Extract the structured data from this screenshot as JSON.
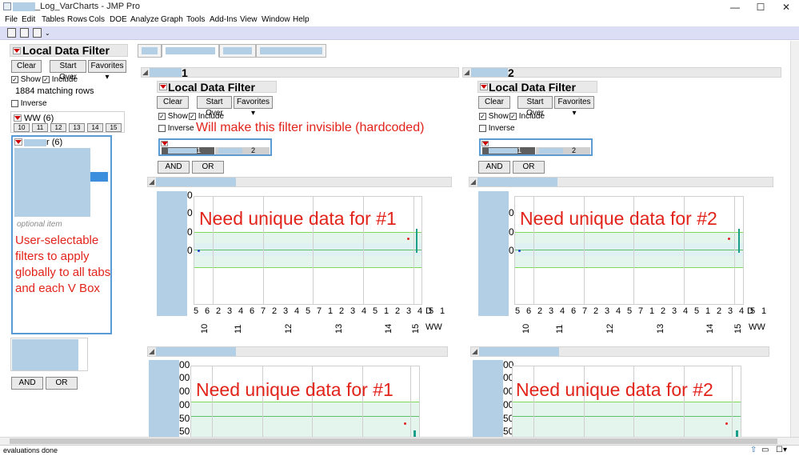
{
  "window": {
    "title_suffix": "_Log_VarCharts - JMP Pro",
    "minimize": "—",
    "maximize": "☐",
    "close": "✕"
  },
  "menu": [
    "File",
    "Edit",
    "Tables",
    "Rows",
    "Cols",
    "DOE",
    "Analyze",
    "Graph",
    "Tools",
    "Add-Ins",
    "View",
    "Window",
    "Help"
  ],
  "left_filter": {
    "title": "Local Data Filter",
    "clear": "Clear",
    "start_over": "Start Over",
    "favorites": "Favorites",
    "show": "Show",
    "include": "Include",
    "matching": "1884 matching rows",
    "inverse": "Inverse",
    "ww_label": "WW (6)",
    "ww_values": [
      "10",
      "11",
      "12",
      "13",
      "14",
      "15"
    ],
    "second_label_suffix": "r (6)",
    "optional_item": "optional item",
    "and": "AND",
    "or": "OR"
  },
  "annotations": {
    "left": "User-selectable filters to apply globally to all tabs and each V Box",
    "invisible": "Will make this filter invisible (hardcoded)",
    "need1": "Need unique data for #1",
    "need2": "Need unique data for #2"
  },
  "panel1": {
    "header_suffix": "1",
    "filter_title": "Local Data Filter",
    "clear": "Clear",
    "start_over": "Start Over",
    "favorites": "Favorites",
    "show": "Show",
    "include": "Include",
    "inverse": "Inverse",
    "slider_left": "1",
    "slider_right": "2",
    "and": "AND",
    "or": "OR"
  },
  "panel2": {
    "header_suffix": "2",
    "filter_title": "Local Data Filter",
    "clear": "Clear",
    "start_over": "Start Over",
    "favorites": "Favorites",
    "show": "Show",
    "include": "Include",
    "inverse": "Inverse",
    "slider_left": "1",
    "slider_right": "2",
    "and": "AND",
    "or": "OR"
  },
  "chart_axis": {
    "day_ticks": [
      "5",
      "6",
      "2",
      "3",
      "4",
      "6",
      "7",
      "2",
      "3",
      "4",
      "5",
      "7",
      "1",
      "2",
      "3",
      "4",
      "5",
      "1",
      "2",
      "3",
      "4",
      "5",
      "1"
    ],
    "day_label": "D",
    "ww_ticks": [
      "10",
      "11",
      "12",
      "13",
      "14",
      "15"
    ],
    "ww_label": "WW",
    "y_ticks_top": [
      "0",
      "0",
      "0",
      "0"
    ],
    "y_ticks_bottom": [
      "00",
      "00",
      "00",
      "00",
      "50",
      "50"
    ]
  },
  "status": {
    "text": "evaluations done"
  }
}
